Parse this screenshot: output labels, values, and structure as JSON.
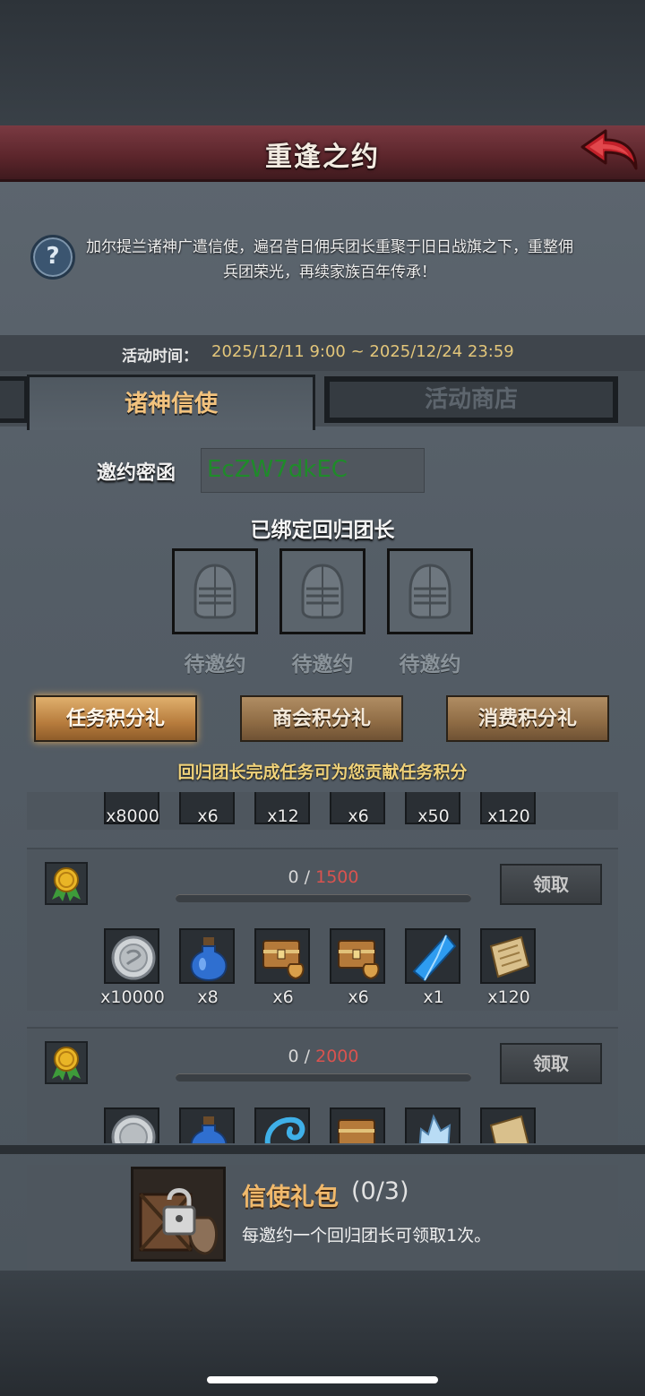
{
  "header": {
    "title": "重逢之约",
    "back_icon": "red-curved-arrow-icon"
  },
  "intro": {
    "text": "加尔提兰诸神广遣信使，遍召昔日佣兵团长重聚于旧日战旗之下，重整佣兵团荣光，再续家族百年传承！"
  },
  "event_time": {
    "label": "活动时间：",
    "value": "2025/12/11 9:00 ~ 2025/12/24 23:59"
  },
  "tabs": [
    {
      "label": "诸神信使"
    },
    {
      "label": "活动商店"
    }
  ],
  "invite": {
    "label": "邀约密函",
    "code": "EcZW7dkEC"
  },
  "bound": {
    "title": "已绑定回归团长",
    "slots": [
      {
        "label": "待邀约"
      },
      {
        "label": "待邀约"
      },
      {
        "label": "待邀约"
      }
    ]
  },
  "gift_tabs": [
    {
      "label": "任务积分礼"
    },
    {
      "label": "商会积分礼"
    },
    {
      "label": "消费积分礼"
    }
  ],
  "hint": "回归团长完成任务可为您贡献任务积分",
  "tiers": [
    {
      "items": [
        {
          "qty": "x8000"
        },
        {
          "qty": "x6"
        },
        {
          "qty": "x12"
        },
        {
          "qty": "x6"
        },
        {
          "qty": "x50"
        },
        {
          "qty": "x120"
        }
      ]
    },
    {
      "progress": {
        "current": "0",
        "sep": " / ",
        "goal": "1500"
      },
      "claim": "领取",
      "items": [
        {
          "icon": "silver-coin-icon",
          "qty": "x10000"
        },
        {
          "icon": "blue-potion-icon",
          "qty": "x8"
        },
        {
          "icon": "treasure-chest-icon",
          "qty": "x6"
        },
        {
          "icon": "treasure-chest-icon",
          "qty": "x6"
        },
        {
          "icon": "blue-crystal-icon",
          "qty": "x1"
        },
        {
          "icon": "scroll-icon",
          "qty": "x120"
        }
      ]
    },
    {
      "progress": {
        "current": "0",
        "sep": " / ",
        "goal": "2000"
      },
      "claim": "领取"
    }
  ],
  "pack": {
    "title": "信使礼包",
    "count": "(0/3)",
    "desc": "每邀约一个回归团长可领取1次。"
  },
  "colors": {
    "accent_gold": "#f2c27d",
    "code_green": "#1f8b2a",
    "goal_red": "#d9534f",
    "title_bar": "#6b2f36"
  }
}
